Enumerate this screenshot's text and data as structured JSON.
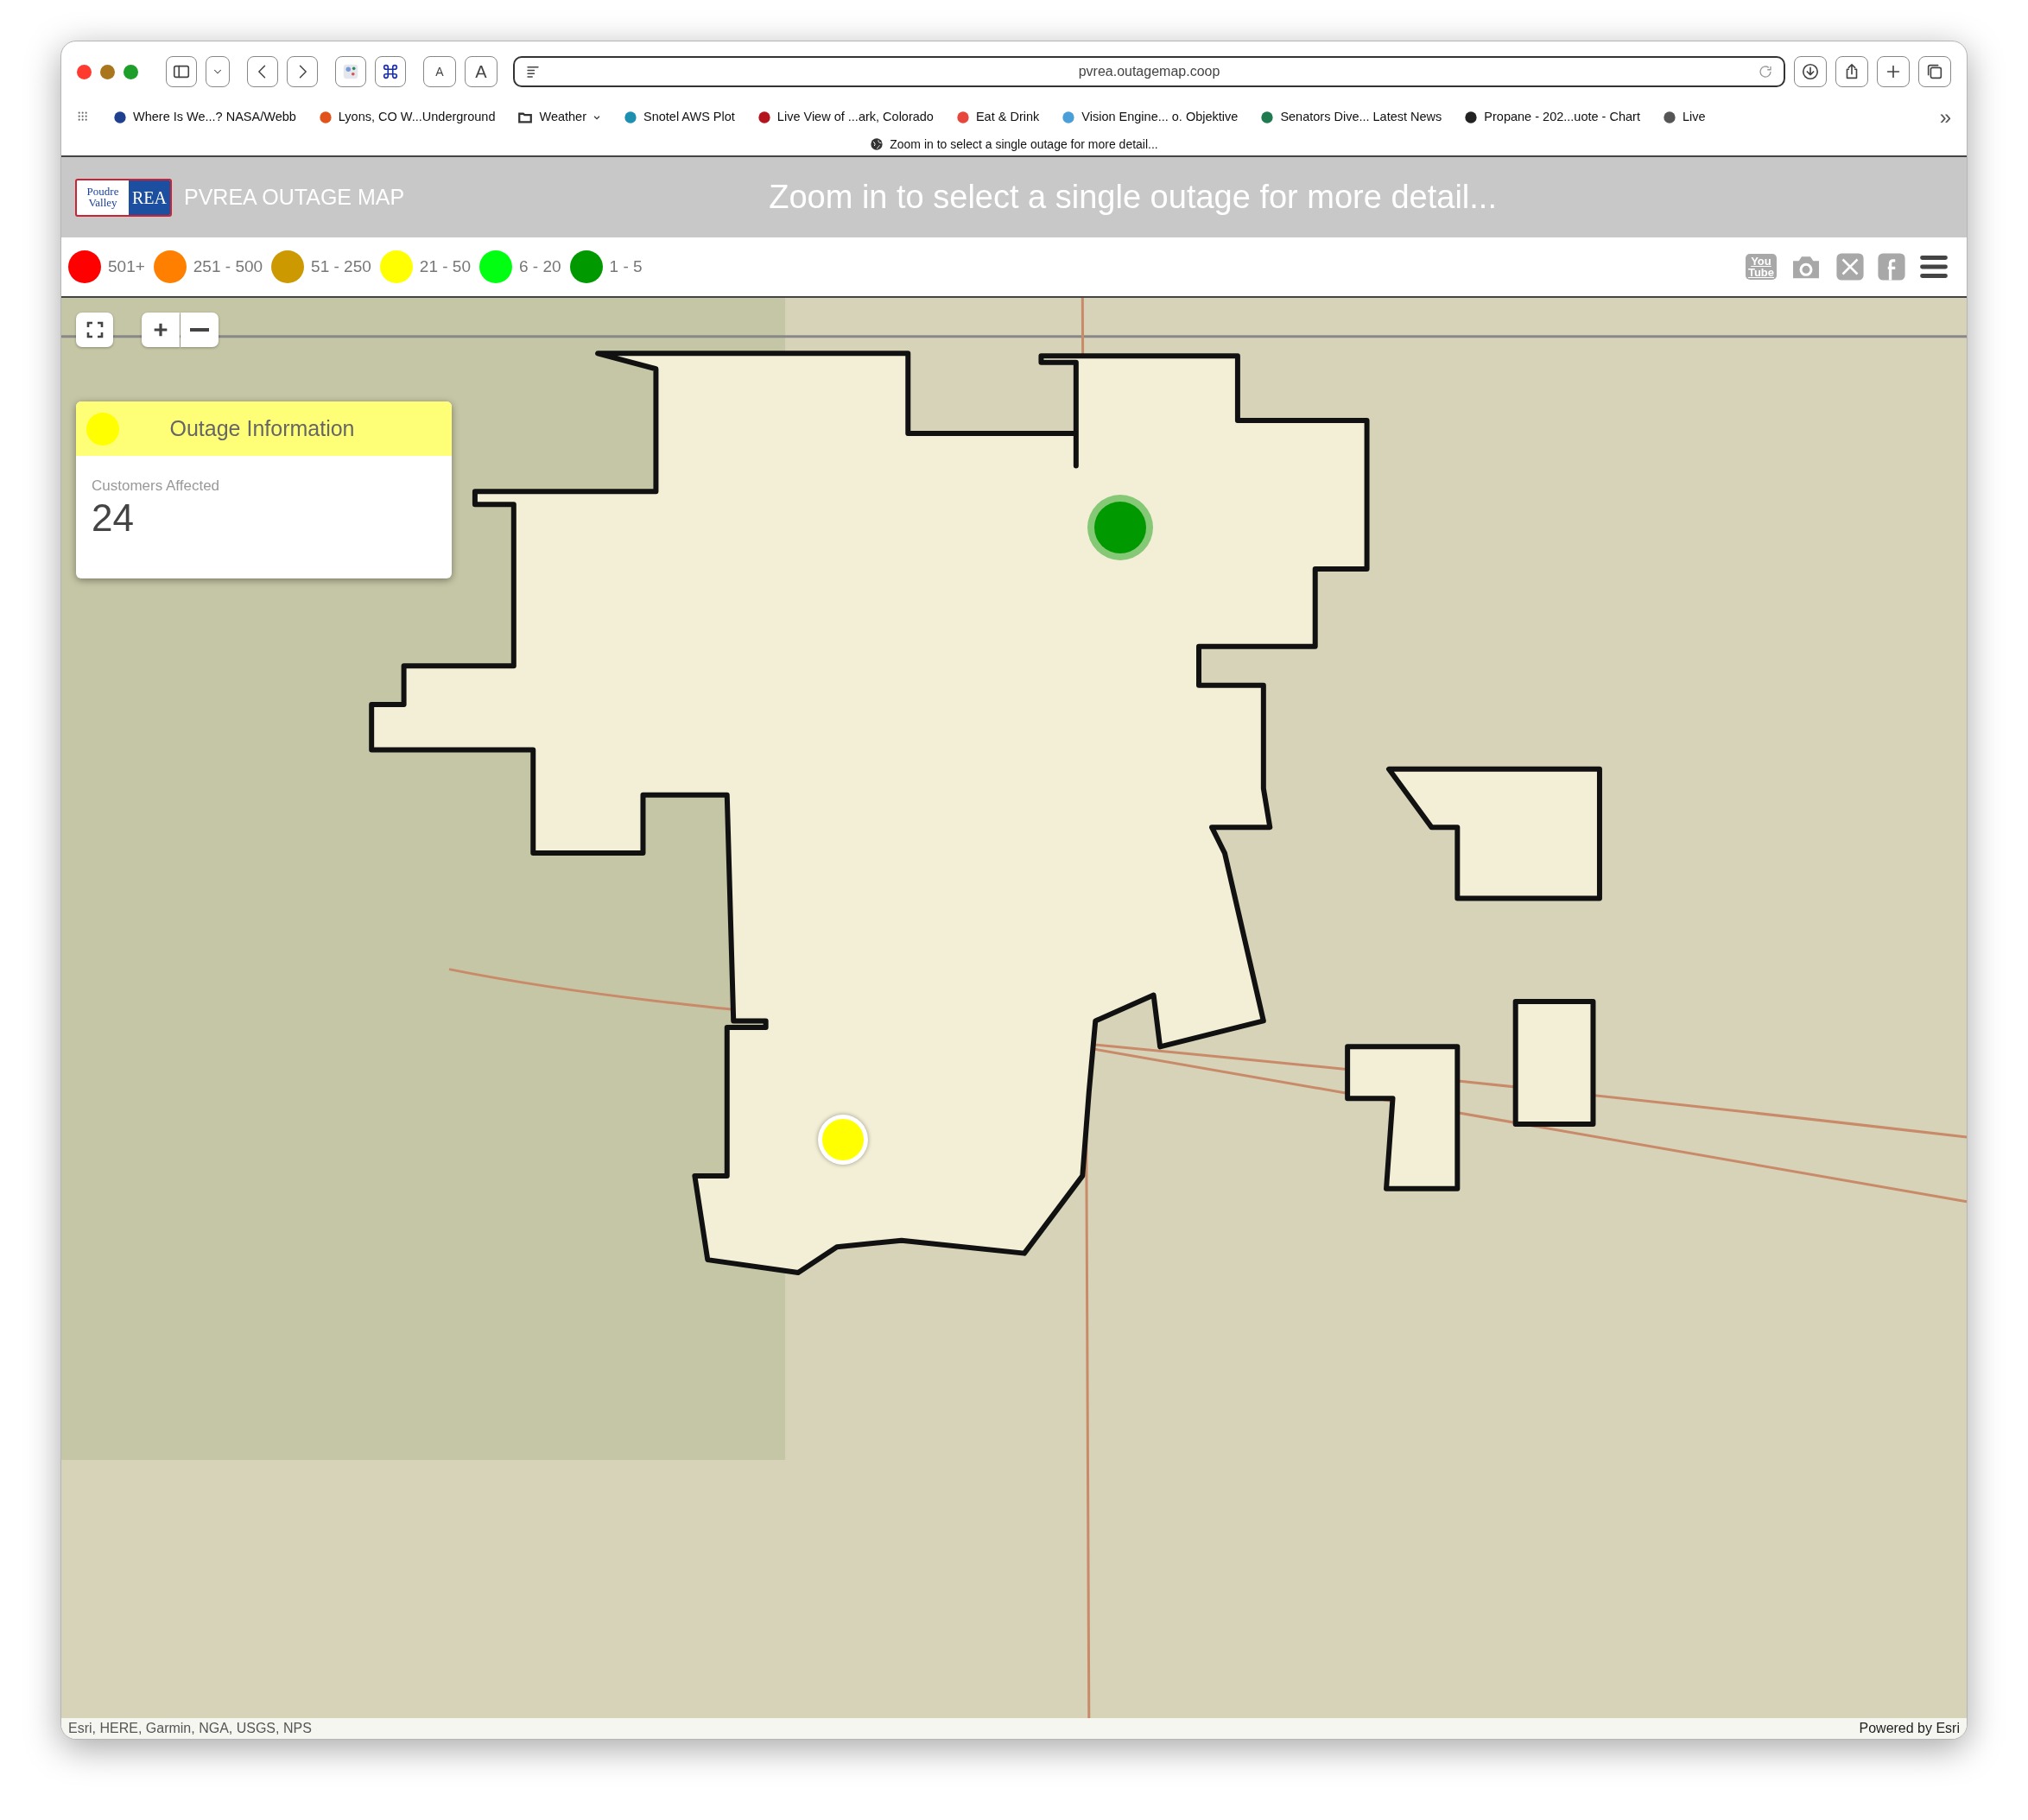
{
  "browser": {
    "text_size_buttons": [
      "A",
      "A"
    ],
    "address": "pvrea.outagemap.coop",
    "bookmarks": [
      {
        "kind": "site",
        "label": "Where Is We...? NASA/Webb",
        "color": "#1f3f8f"
      },
      {
        "kind": "site",
        "label": "Lyons, CO W...Underground",
        "color": "#e2531b"
      },
      {
        "kind": "folder",
        "label": "Weather",
        "color": "#333333"
      },
      {
        "kind": "site",
        "label": "Snotel AWS Plot",
        "color": "#1d8fb0"
      },
      {
        "kind": "site",
        "label": "Live View of ...ark, Colorado",
        "color": "#b3141e"
      },
      {
        "kind": "site",
        "label": "Eat & Drink",
        "color": "#e8453c"
      },
      {
        "kind": "site",
        "label": "Vision Engine... o. Objektive",
        "color": "#4a9fd8"
      },
      {
        "kind": "site",
        "label": "Senators Dive... Latest News",
        "color": "#1f7a4f"
      },
      {
        "kind": "site",
        "label": "Propane - 202...uote - Chart",
        "color": "#222222"
      },
      {
        "kind": "site",
        "label": "Live",
        "color": "#555555"
      }
    ],
    "more": "»",
    "status": "Zoom in to select a single outage for more detail..."
  },
  "header": {
    "logo": {
      "line_1": "Poudre",
      "line_2": "Valley",
      "mark": "REA"
    },
    "title": "PVREA OUTAGE MAP",
    "message": "Zoom in to select a single outage for more detail..."
  },
  "legend": [
    {
      "label": "501+",
      "color": "#ff0000"
    },
    {
      "label": "251 - 500",
      "color": "#ff8000"
    },
    {
      "label": "51 - 250",
      "color": "#cc9900"
    },
    {
      "label": "21 - 50",
      "color": "#ffff00"
    },
    {
      "label": "6 - 20",
      "color": "#00ff11"
    },
    {
      "label": "1 - 5",
      "color": "#009900"
    }
  ],
  "social": {
    "youtube": [
      "You",
      "Tube"
    ]
  },
  "info_panel": {
    "title": "Outage Information",
    "color": "#ffff00",
    "field_label": "Customers Affected",
    "value": "24"
  },
  "map": {
    "markers": [
      {
        "color": "#009900",
        "selected": false
      },
      {
        "color": "#ffff00",
        "selected": true
      }
    ],
    "attribution": "Esri, HERE, Garmin, NGA, USGS, NPS",
    "powered_by": "Powered by Esri"
  }
}
